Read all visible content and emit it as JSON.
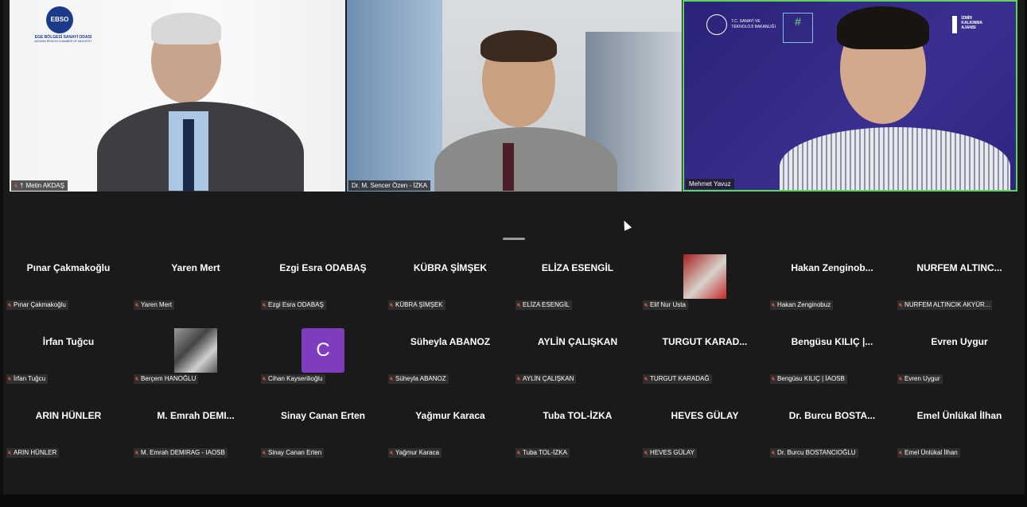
{
  "videos": [
    {
      "name": "Metin AKDAŞ",
      "pinned": true
    },
    {
      "name": "Dr. M. Sencer Özen - İZKA"
    },
    {
      "name": "Mehmet Yavuz"
    }
  ],
  "logos": {
    "ebso_abbr": "EBSO",
    "ebso_name": "EGE BÖLGESİ SANAYİ ODASI",
    "ebso_sub": "AEGEAN REGION CHAMBER OF INDUSTRY",
    "ministry_line1": "T.C. SANAYİ VE",
    "ministry_line2": "TEKNOLOJİ BAKANLIĞI",
    "hashtag": "#",
    "kalkinma_line1": "İZMİR",
    "kalkinma_line2": "KALKINMA",
    "kalkinma_line3": "AJANSI"
  },
  "participants": [
    [
      {
        "display": "Pınar Çakmakoğlu",
        "label": "Pınar Çakmakoğlu"
      },
      {
        "display": "Yaren Mert",
        "label": "Yaren Mert"
      },
      {
        "display": "Ezgi Esra ODABAŞ",
        "label": "Ezgi Esra ODABAŞ"
      },
      {
        "display": "KÜBRA ŞİMŞEK",
        "label": "KÜBRA ŞİMŞEK"
      },
      {
        "display": "ELİZA ESENGİL",
        "label": "ELİZA ESENGİL"
      },
      {
        "display": "",
        "label": "Elif Nur Usta",
        "avatar": "photo"
      },
      {
        "display": "Hakan Zenginob...",
        "label": "Hakan Zenginobuz"
      },
      {
        "display": "NURFEM ALTINC...",
        "label": "NURFEM ALTINCIK AKYÜR..."
      }
    ],
    [
      {
        "display": "İrfan Tuğcu",
        "label": "İrfan Tuğcu"
      },
      {
        "display": "",
        "label": "Berçem HANOĞLU",
        "avatar": "bw"
      },
      {
        "display": "",
        "label": "Cihan Kayserilioğlu",
        "avatar": "C"
      },
      {
        "display": "Süheyla ABANOZ",
        "label": "Süheyla ABANOZ"
      },
      {
        "display": "AYLİN ÇALIŞKAN",
        "label": "AYLİN ÇALIŞKAN"
      },
      {
        "display": "TURGUT KARAD...",
        "label": "TURGUT KARADAĞ"
      },
      {
        "display": "Bengüsu KILIÇ |...",
        "label": "Bengüsu KILIÇ | İAOSB"
      },
      {
        "display": "Evren Uygur",
        "label": "Evren Uygur"
      }
    ],
    [
      {
        "display": "ARIN HÜNLER",
        "label": "ARIN HÜNLER"
      },
      {
        "display": "M. Emrah DEMI...",
        "label": "M. Emrah DEMIRAG - IAOSB"
      },
      {
        "display": "Sinay Canan Erten",
        "label": "Sinay Canan Erten"
      },
      {
        "display": "Yağmur Karaca",
        "label": "Yağmur Karaca"
      },
      {
        "display": "Tuba TOL-İZKA",
        "label": "Tuba TOL-İZKA"
      },
      {
        "display": "HEVES GÜLAY",
        "label": "HEVES GÜLAY"
      },
      {
        "display": "Dr. Burcu BOSTA...",
        "label": "Dr. Burcu BOSTANCIOĞLU"
      },
      {
        "display": "Emel Ünlükal İlhan",
        "label": "Emel Ünlükal İlhan"
      }
    ]
  ],
  "colors": {
    "active_speaker_border": "#5fd35a",
    "mic_muted": "#e5533d",
    "avatar_c": "#7f3cbf"
  },
  "icons": {
    "mic_muted": "mic-muted-icon",
    "pin": "pin-icon",
    "cursor": "mouse-cursor-icon"
  }
}
